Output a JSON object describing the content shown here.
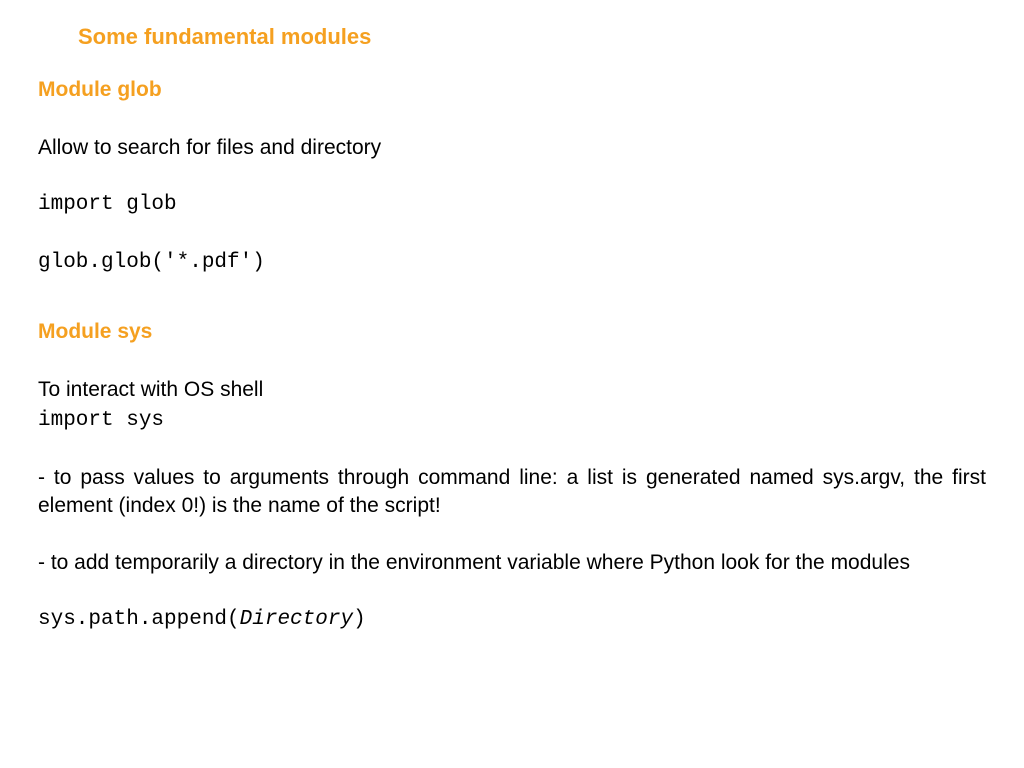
{
  "title": "Some fundamental modules",
  "glob": {
    "heading": "Module glob",
    "description": "Allow to search for files and directory",
    "code1": "import glob",
    "code2": "glob.glob('*.pdf')"
  },
  "sys": {
    "heading": "Module sys",
    "description": "To interact with OS shell",
    "code1": "import sys",
    "bullet1": "- to pass values to arguments through command line: a list is generated named sys.argv, the first element (index 0!)  is the name of the script!",
    "bullet2": "- to add temporarily a directory in the environment variable where Python look for the modules",
    "code2_prefix": "sys.path.append(",
    "code2_arg": "Directory",
    "code2_suffix": ")"
  }
}
